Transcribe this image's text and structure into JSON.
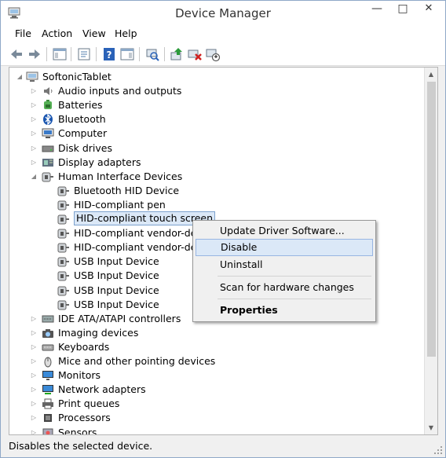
{
  "window": {
    "title": "Device Manager",
    "min_glyph": "—",
    "max_glyph": "□",
    "close_glyph": "✕"
  },
  "menubar": {
    "items": [
      "File",
      "Action",
      "View",
      "Help"
    ]
  },
  "toolbar": {
    "icons": [
      "back-arrow-icon",
      "forward-arrow-icon",
      "show-hide-console-tree-icon",
      "properties-sheet-icon",
      "help-icon",
      "action-pane-icon",
      "scan-hardware-icon",
      "update-driver-icon",
      "uninstall-device-icon",
      "disable-device-icon"
    ]
  },
  "tree": {
    "root": "SoftonicTablet",
    "categories": [
      {
        "label": "Audio inputs and outputs",
        "icon": "speaker-icon"
      },
      {
        "label": "Batteries",
        "icon": "battery-icon"
      },
      {
        "label": "Bluetooth",
        "icon": "bluetooth-icon"
      },
      {
        "label": "Computer",
        "icon": "computer-icon"
      },
      {
        "label": "Disk drives",
        "icon": "disk-drive-icon"
      },
      {
        "label": "Display adapters",
        "icon": "display-adapter-icon"
      },
      {
        "label": "Human Interface Devices",
        "icon": "hid-icon",
        "expanded": true
      }
    ],
    "hid_children": [
      "Bluetooth HID Device",
      "HID-compliant pen",
      "HID-compliant touch screen",
      "HID-compliant vendor-defin",
      "HID-compliant vendor-defin",
      "USB Input Device",
      "USB Input Device",
      "USB Input Device",
      "USB Input Device"
    ],
    "selected_child": 2,
    "categories_after": [
      {
        "label": "IDE ATA/ATAPI controllers",
        "icon": "ide-controller-icon"
      },
      {
        "label": "Imaging devices",
        "icon": "camera-icon"
      },
      {
        "label": "Keyboards",
        "icon": "keyboard-icon"
      },
      {
        "label": "Mice and other pointing devices",
        "icon": "mouse-icon"
      },
      {
        "label": "Monitors",
        "icon": "monitor-icon"
      },
      {
        "label": "Network adapters",
        "icon": "network-adapter-icon"
      },
      {
        "label": "Print queues",
        "icon": "printer-icon"
      },
      {
        "label": "Processors",
        "icon": "processor-icon"
      },
      {
        "label": "Sensors",
        "icon": "sensor-icon"
      }
    ]
  },
  "context_menu": {
    "items": [
      {
        "label": "Update Driver Software...",
        "highlighted": false,
        "bold": false
      },
      {
        "label": "Disable",
        "highlighted": true,
        "bold": false
      },
      {
        "label": "Uninstall",
        "highlighted": false,
        "bold": false
      },
      {
        "label": "Scan for hardware changes",
        "highlighted": false,
        "bold": false
      },
      {
        "label": "Properties",
        "highlighted": false,
        "bold": true
      }
    ]
  },
  "statusbar": {
    "text": "Disables the selected device."
  },
  "colors": {
    "selection_bg": "#dbe8f7",
    "selection_border": "#7da2ce",
    "window_border": "#8fa8c8"
  }
}
